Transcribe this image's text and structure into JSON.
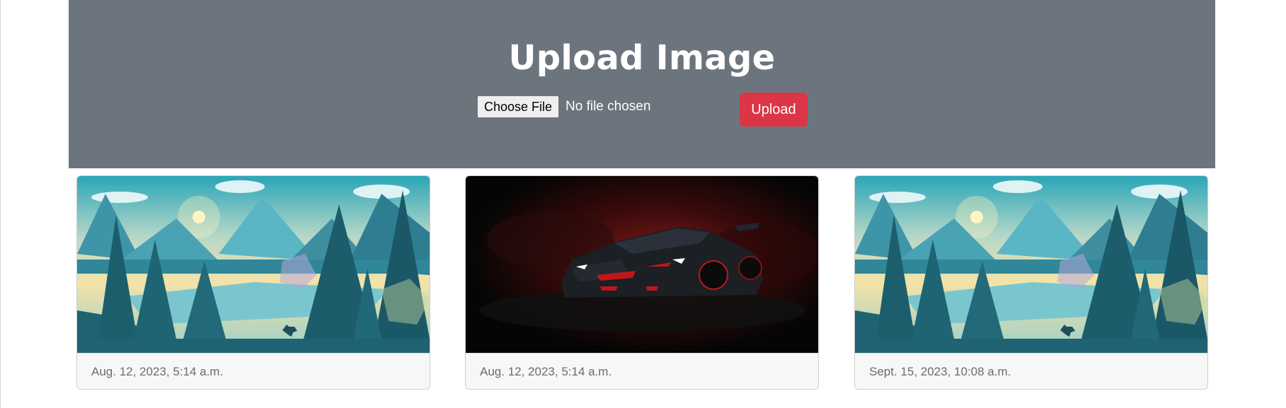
{
  "header": {
    "title": "Upload Image",
    "choose_file_label": "Choose File",
    "file_status": "No file chosen",
    "upload_label": "Upload",
    "background_color": "#6c757d",
    "upload_color": "#dc3545"
  },
  "gallery": {
    "cards": [
      {
        "image": "landscape-illustration",
        "date": "Aug. 12, 2023, 5:14 a.m."
      },
      {
        "image": "sports-car-photo",
        "date": "Aug. 12, 2023, 5:14 a.m."
      },
      {
        "image": "landscape-illustration",
        "date": "Sept. 15, 2023, 10:08 a.m."
      }
    ]
  }
}
